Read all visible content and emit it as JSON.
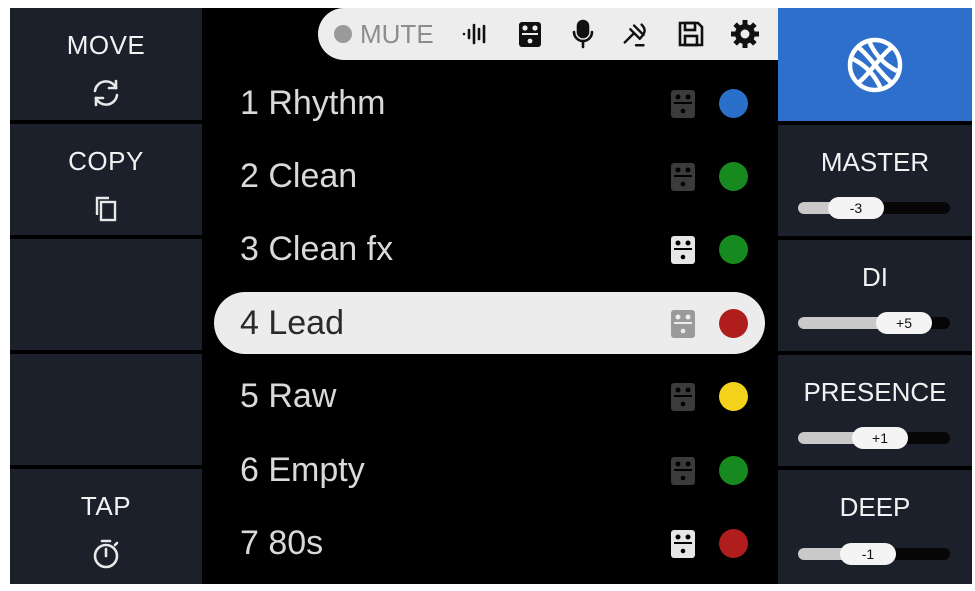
{
  "left": {
    "move_label": "MOVE",
    "copy_label": "COPY",
    "tap_label": "TAP"
  },
  "toolbar": {
    "mute_label": "MUTE",
    "icons": [
      "waveform-icon",
      "pedal-icon",
      "microphone-icon",
      "tuner-fork-icon",
      "save-icon",
      "gear-icon"
    ]
  },
  "presets": [
    {
      "label": "1 Rhythm",
      "color": "#2a6fc9",
      "pedal_on": false,
      "selected": false
    },
    {
      "label": "2 Clean",
      "color": "#168a1e",
      "pedal_on": false,
      "selected": false
    },
    {
      "label": "3 Clean fx",
      "color": "#168a1e",
      "pedal_on": true,
      "selected": false
    },
    {
      "label": "4 Lead",
      "color": "#b01d1d",
      "pedal_on": true,
      "selected": true
    },
    {
      "label": "5 Raw",
      "color": "#f2d21b",
      "pedal_on": false,
      "selected": false
    },
    {
      "label": "6 Empty",
      "color": "#168a1e",
      "pedal_on": false,
      "selected": false
    },
    {
      "label": "7 80s",
      "color": "#b01d1d",
      "pedal_on": true,
      "selected": false
    }
  ],
  "right": {
    "globe_icon": "globe-icon",
    "controls": [
      {
        "label": "MASTER",
        "value": "-3",
        "level": 0.35
      },
      {
        "label": "DI",
        "value": "+5",
        "level": 0.75
      },
      {
        "label": "PRESENCE",
        "value": "+1",
        "level": 0.55
      },
      {
        "label": "DEEP",
        "value": "-1",
        "level": 0.45
      }
    ]
  },
  "colors": {
    "accent": "#2d6fca",
    "panel": "#1b202b",
    "background": "#000000"
  }
}
